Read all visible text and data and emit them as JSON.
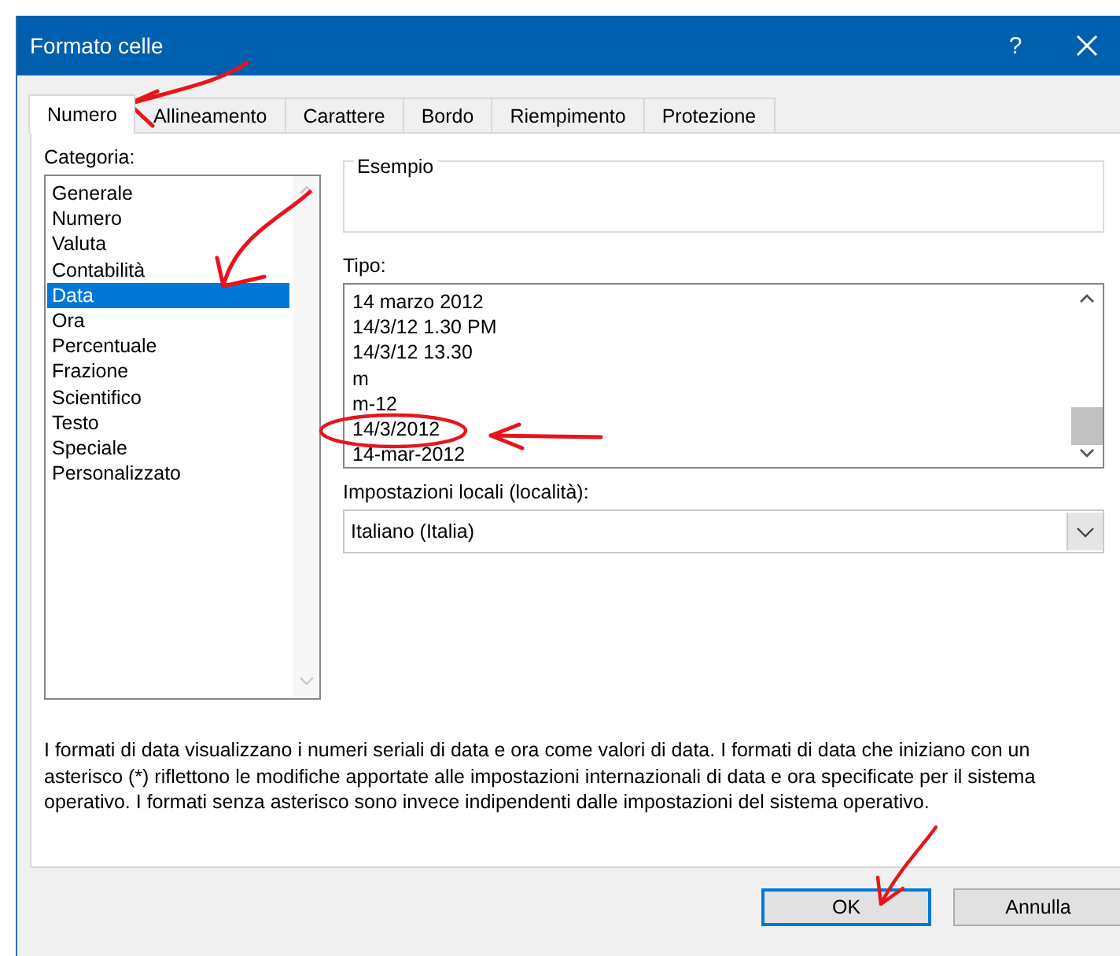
{
  "window": {
    "title": "Formato celle",
    "help": "?"
  },
  "tabs": [
    {
      "label": "Numero",
      "selected": true
    },
    {
      "label": "Allineamento",
      "selected": false
    },
    {
      "label": "Carattere",
      "selected": false
    },
    {
      "label": "Bordo",
      "selected": false
    },
    {
      "label": "Riempimento",
      "selected": false
    },
    {
      "label": "Protezione",
      "selected": false
    }
  ],
  "category": {
    "label": "Categoria:",
    "items": [
      {
        "label": "Generale",
        "selected": false
      },
      {
        "label": "Numero",
        "selected": false
      },
      {
        "label": "Valuta",
        "selected": false
      },
      {
        "label": "Contabilità",
        "selected": false
      },
      {
        "label": "Data",
        "selected": true
      },
      {
        "label": "Ora",
        "selected": false
      },
      {
        "label": "Percentuale",
        "selected": false
      },
      {
        "label": "Frazione",
        "selected": false
      },
      {
        "label": "Scientifico",
        "selected": false
      },
      {
        "label": "Testo",
        "selected": false
      },
      {
        "label": "Speciale",
        "selected": false
      },
      {
        "label": "Personalizzato",
        "selected": false
      }
    ]
  },
  "sample": {
    "label": "Esempio"
  },
  "type": {
    "label": "Tipo:",
    "items": [
      "14 marzo 2012",
      "14/3/12 1.30 PM",
      "14/3/12 13.30",
      "m",
      "m-12",
      "14/3/2012",
      "14-mar-2012"
    ]
  },
  "locale": {
    "label": "Impostazioni locali (località):",
    "value": "Italiano (Italia)"
  },
  "description": "I formati di data visualizzano i numeri seriali di data e ora come valori di data. I formati di data che iniziano con un asterisco (*) riflettono le modifiche apportate alle impostazioni internazionali di data e ora specificate per il sistema operativo. I formati senza asterisco sono invece indipendenti dalle impostazioni del sistema operativo.",
  "buttons": [
    {
      "label": "OK",
      "kind": "default"
    },
    {
      "label": "Annulla",
      "kind": "normal"
    }
  ]
}
